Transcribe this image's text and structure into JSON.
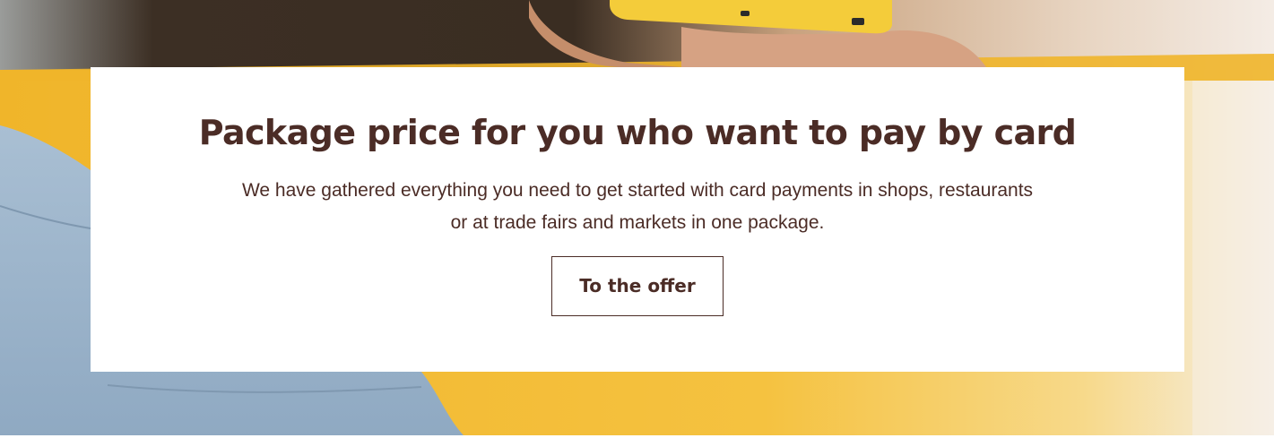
{
  "promo": {
    "headline": "Package price for you who want to pay by card",
    "description": "We have gathered everything you need to get started with card payments in shops, restaurants or at trade fairs and markets in one package.",
    "cta_label": "To the offer"
  },
  "colors": {
    "accent_text": "#4b2c26",
    "background_yellow": "#f2bd33",
    "card_background": "#ffffff"
  }
}
